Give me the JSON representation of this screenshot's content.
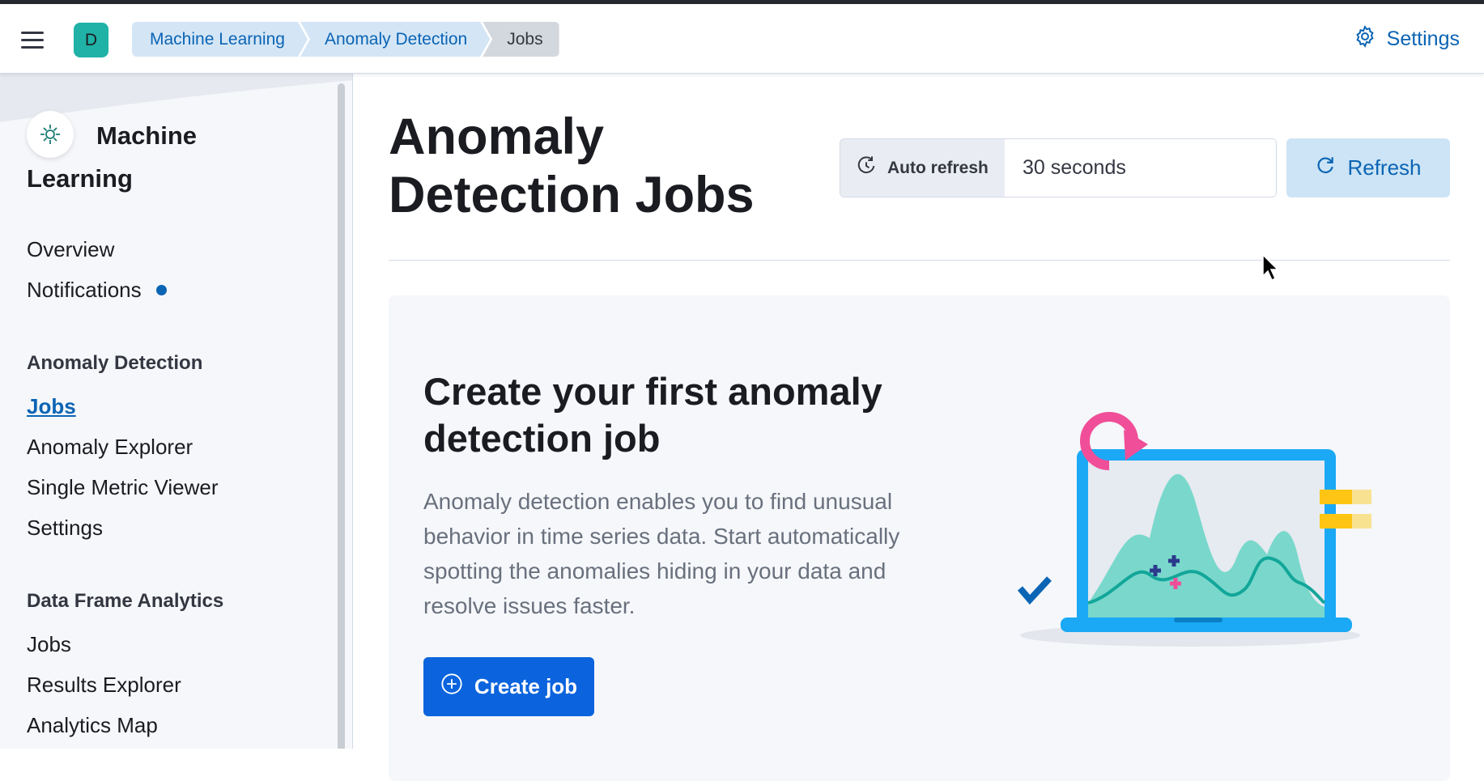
{
  "header": {
    "avatar_letter": "D",
    "breadcrumbs": [
      "Machine Learning",
      "Anomaly Detection",
      "Jobs"
    ],
    "settings_label": "Settings"
  },
  "sidebar": {
    "title": "Machine Learning",
    "items_top": [
      "Overview",
      "Notifications"
    ],
    "groups": [
      {
        "label": "Anomaly Detection",
        "items": [
          "Jobs",
          "Anomaly Explorer",
          "Single Metric Viewer",
          "Settings"
        ]
      },
      {
        "label": "Data Frame Analytics",
        "items": [
          "Jobs",
          "Results Explorer",
          "Analytics Map"
        ]
      }
    ],
    "active_item": "Jobs"
  },
  "main": {
    "title": "Anomaly Detection Jobs",
    "auto_refresh_label": "Auto refresh",
    "auto_refresh_value": "30 seconds",
    "refresh_label": "Refresh",
    "empty_state": {
      "title": "Create your first anomaly detection job",
      "body": "Anomaly detection enables you to find unusual behavior in time series data. Start automatically spotting the anomalies hiding in your data and resolve issues faster.",
      "cta": "Create job"
    }
  },
  "colors": {
    "primary": "#0b64dd",
    "link": "#0b64b4",
    "avatar": "#20b2a6",
    "breadcrumb_bg": "#d4e6f6"
  }
}
